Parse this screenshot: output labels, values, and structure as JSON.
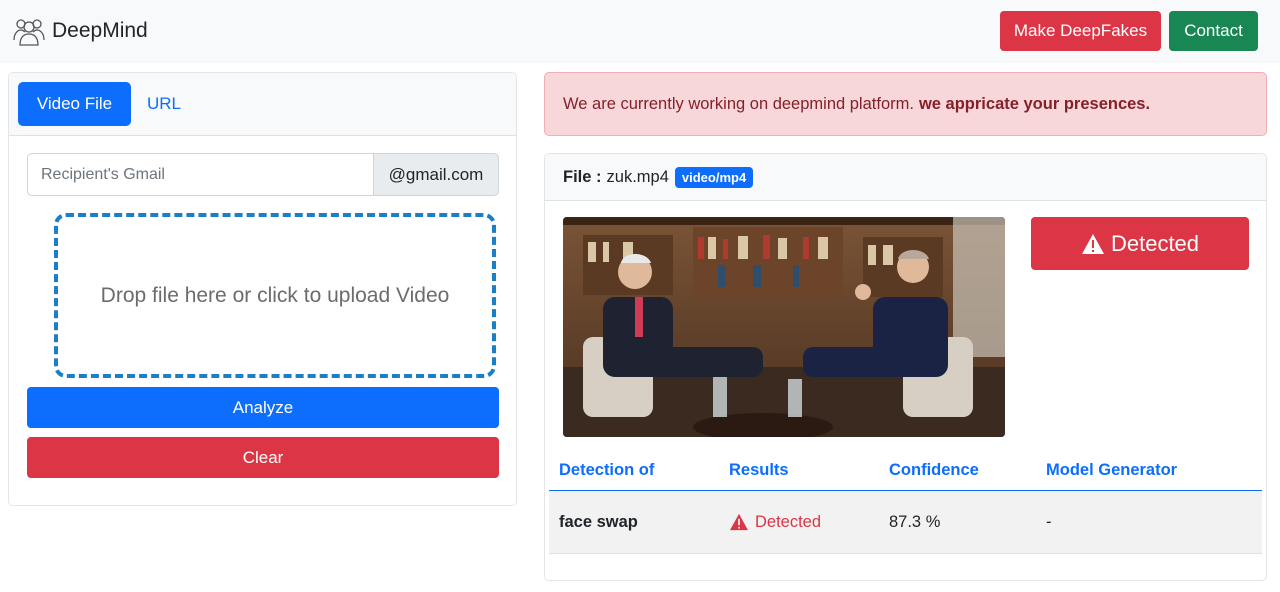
{
  "navbar": {
    "brand": "DeepMind",
    "brand_icon": "people-group-icon",
    "make_deepfakes": "Make DeepFakes",
    "contact": "Contact"
  },
  "left_panel": {
    "tabs": [
      "Video File",
      "URL"
    ],
    "active_tab": "Video File",
    "gmail_placeholder": "Recipient's Gmail",
    "gmail_suffix": "@gmail.com",
    "dropzone_text": "Drop file here or click to upload Video",
    "analyze": "Analyze",
    "clear": "Clear"
  },
  "alert": {
    "text": "We are currently working on deepmind platform.",
    "bold": "we appricate your presences."
  },
  "result": {
    "file_label": "File :",
    "file_name": "zuk.mp4",
    "mime_badge": "video/mp4",
    "status": "Detected",
    "status_icon": "warning-triangle-icon",
    "table": {
      "headers": [
        "Detection of",
        "Results",
        "Confidence",
        "Model Generator"
      ],
      "rows": [
        {
          "detection_of": "face swap",
          "result": "Detected",
          "confidence": "87.3 %",
          "model_generator": "-"
        }
      ]
    }
  },
  "colors": {
    "primary": "#0d6efd",
    "danger": "#dc3545",
    "success": "#198754",
    "alert_bg": "#f8d7da",
    "alert_text": "#842029"
  }
}
